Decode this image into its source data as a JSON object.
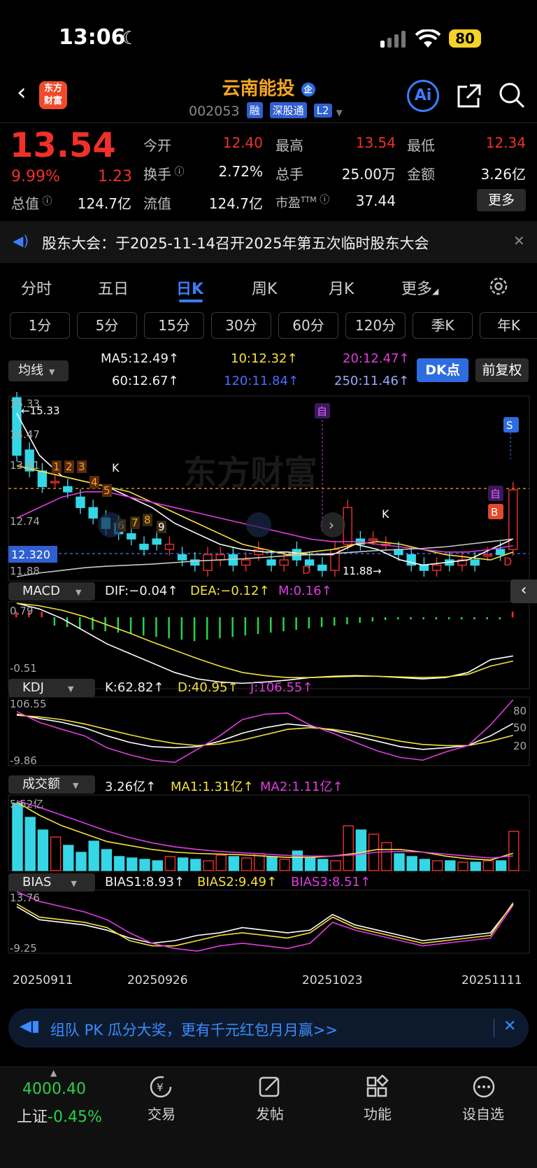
{
  "status": {
    "time": "13:06",
    "battery": "80"
  },
  "header": {
    "title": "云南能投",
    "title_badge": "企",
    "code": "002053",
    "tags": [
      "融",
      "深股通",
      "L2"
    ],
    "logo_lines": [
      "东方",
      "财富"
    ],
    "ai_label": "Ai"
  },
  "quote": {
    "price": "13.54",
    "change_pct": "9.99%",
    "change": "1.23",
    "open_label": "今开",
    "open": "12.40",
    "high_label": "最高",
    "high": "13.54",
    "low_label": "最低",
    "low": "12.34",
    "turnover_label": "换手",
    "turnover": "2.72%",
    "volume_label": "总手",
    "volume": "25.00万",
    "amount_label": "金额",
    "amount": "3.26亿",
    "mktcap_label": "总值",
    "mktcap": "124.7亿",
    "float_label": "流值",
    "float": "124.7亿",
    "pe_label": "市盈",
    "pe_sup": "TTM",
    "pe": "37.44",
    "more_label": "更多"
  },
  "notice": {
    "text": "股东大会：于2025-11-14召开2025年第五次临时股东大会"
  },
  "tabs": [
    "分时",
    "五日",
    "日K",
    "周K",
    "月K",
    "更多"
  ],
  "periods": [
    "1分",
    "5分",
    "15分",
    "30分",
    "60分",
    "120分",
    "季K",
    "年K"
  ],
  "ma_legend": {
    "button": "均线",
    "ma5": "MA5:12.49↑",
    "ma10": "10:12.32↑",
    "ma20": "20:12.47↑",
    "ma60": "60:12.67↑",
    "ma120": "120:11.84↑",
    "ma250": "250:11.46↑",
    "dk_button": "DK点",
    "fq_button": "前复权"
  },
  "kline_labels": {
    "y_top": "15.33",
    "y_2": "14.47",
    "y_3": "13.61",
    "y_4": "12.74",
    "y_cur": "12.320",
    "y_bottom": "11.88",
    "high_mark": "←15.33",
    "low_mark": "11.88→",
    "zi": "自",
    "s": "S",
    "b": "B",
    "d": "D",
    "k": "K",
    "seq": [
      "1",
      "2",
      "3",
      "4",
      "5",
      "6",
      "7",
      "8",
      "9"
    ]
  },
  "macd": {
    "button": "MACD",
    "dif": "DIF:−0.04↑",
    "dea": "DEA:−0.12↑",
    "m": "M:0.16↑",
    "y_top": "0.79",
    "y_bottom": "-0.51"
  },
  "kdj": {
    "button": "KDJ",
    "k": "K:62.82↑",
    "d": "D:40.95↑",
    "j": "J:106.55↑",
    "y_top": "106.55",
    "y_bottom": "-9.86",
    "r80": "80",
    "r50": "50",
    "r20": "20"
  },
  "vol": {
    "button": "成交额",
    "v": "3.26亿↑",
    "ma1": "MA1:1.31亿↑",
    "ma2": "MA2:1.11亿↑",
    "y_top": "5.52亿"
  },
  "bias": {
    "button": "BIAS",
    "b1": "BIAS1:8.93↑",
    "b2": "BIAS2:9.49↑",
    "b3": "BIAS3:8.51↑",
    "y_top": "13.76",
    "y_bottom": "-9.25"
  },
  "dates": [
    "20250911",
    "20250926",
    "20251023",
    "20251111"
  ],
  "banner": {
    "text": "组队 PK 瓜分大奖，更有千元红包月月赢>>"
  },
  "bottom_nav": {
    "index_value": "4000.40",
    "index_name": "上证",
    "index_change": "-0.45%",
    "items": [
      "交易",
      "发帖",
      "功能",
      "设自选"
    ]
  },
  "colors": {
    "up": "#f0302a",
    "down": "#35d6e6",
    "accent": "#3a7dff",
    "title": "#f5a623"
  }
}
